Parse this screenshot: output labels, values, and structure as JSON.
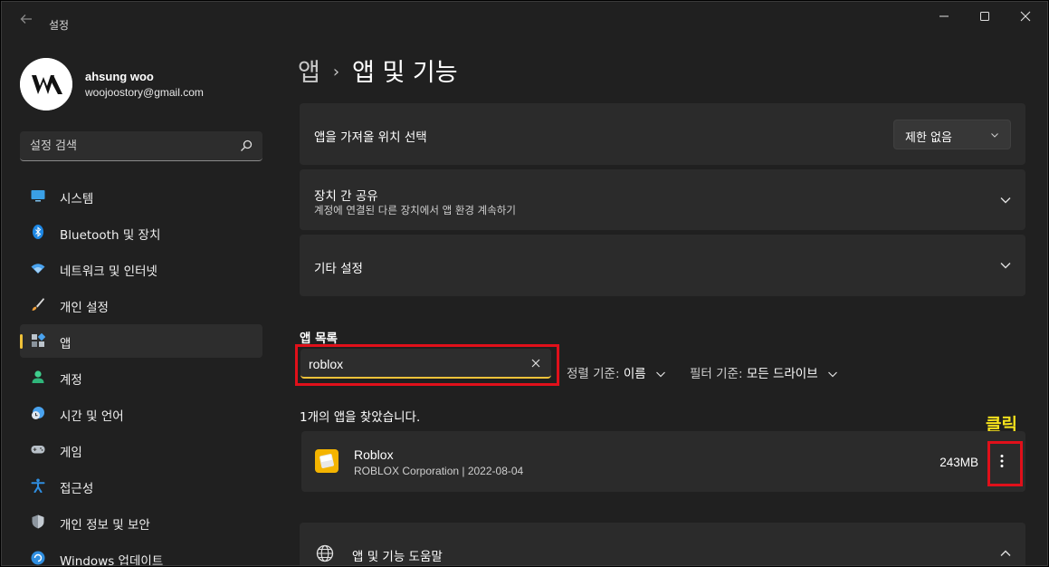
{
  "window": {
    "title": "설정",
    "minimize_symbol": "—",
    "maximize_symbol": "☐",
    "close_symbol": "✕"
  },
  "profile": {
    "name": "ahsung woo",
    "email": "woojoostory@gmail.com"
  },
  "sidebar": {
    "search_placeholder": "설정 검색",
    "items": [
      {
        "label": "시스템",
        "icon": "monitor-icon",
        "active": false
      },
      {
        "label": "Bluetooth 및 장치",
        "icon": "bluetooth-icon",
        "active": false
      },
      {
        "label": "네트워크 및 인터넷",
        "icon": "wifi-icon",
        "active": false
      },
      {
        "label": "개인 설정",
        "icon": "brush-icon",
        "active": false
      },
      {
        "label": "앱",
        "icon": "apps-icon",
        "active": true
      },
      {
        "label": "계정",
        "icon": "person-icon",
        "active": false
      },
      {
        "label": "시간 및 언어",
        "icon": "clock-globe-icon",
        "active": false
      },
      {
        "label": "게임",
        "icon": "gamepad-icon",
        "active": false
      },
      {
        "label": "접근성",
        "icon": "accessibility-icon",
        "active": false
      },
      {
        "label": "개인 정보 및 보안",
        "icon": "shield-icon",
        "active": false
      },
      {
        "label": "Windows 업데이트",
        "icon": "update-icon",
        "active": false
      }
    ]
  },
  "breadcrumb": {
    "parent": "앱",
    "separator": "›",
    "current": "앱 및 기능"
  },
  "settings": {
    "install_source": {
      "title": "앱을 가져올 위치 선택",
      "value": "제한 없음"
    },
    "share": {
      "title": "장치 간 공유",
      "subtitle": "계정에 연결된 다른 장치에서 앱 환경 계속하기"
    },
    "other": {
      "title": "기타 설정"
    }
  },
  "app_list": {
    "title": "앱 목록",
    "search_value": "roblox",
    "sort_label": "정렬 기준:",
    "sort_value": "이름",
    "filter_label": "필터 기준:",
    "filter_value": "모든 드라이브",
    "result_text": "1개의 앱을 찾았습니다.",
    "apps": [
      {
        "name": "Roblox",
        "publisher": "ROBLOX Corporation",
        "date": "2022-08-04",
        "meta": "ROBLOX Corporation  |  2022-08-04",
        "size": "243MB"
      }
    ]
  },
  "annotation": {
    "text": "클릭",
    "color": "#f6e21c",
    "box_color": "#e0101a"
  },
  "help": {
    "title": "앱 및 기능 도움말"
  },
  "colors": {
    "accent": "#f0c239",
    "background": "#202020",
    "card": "#2b2b2b"
  }
}
